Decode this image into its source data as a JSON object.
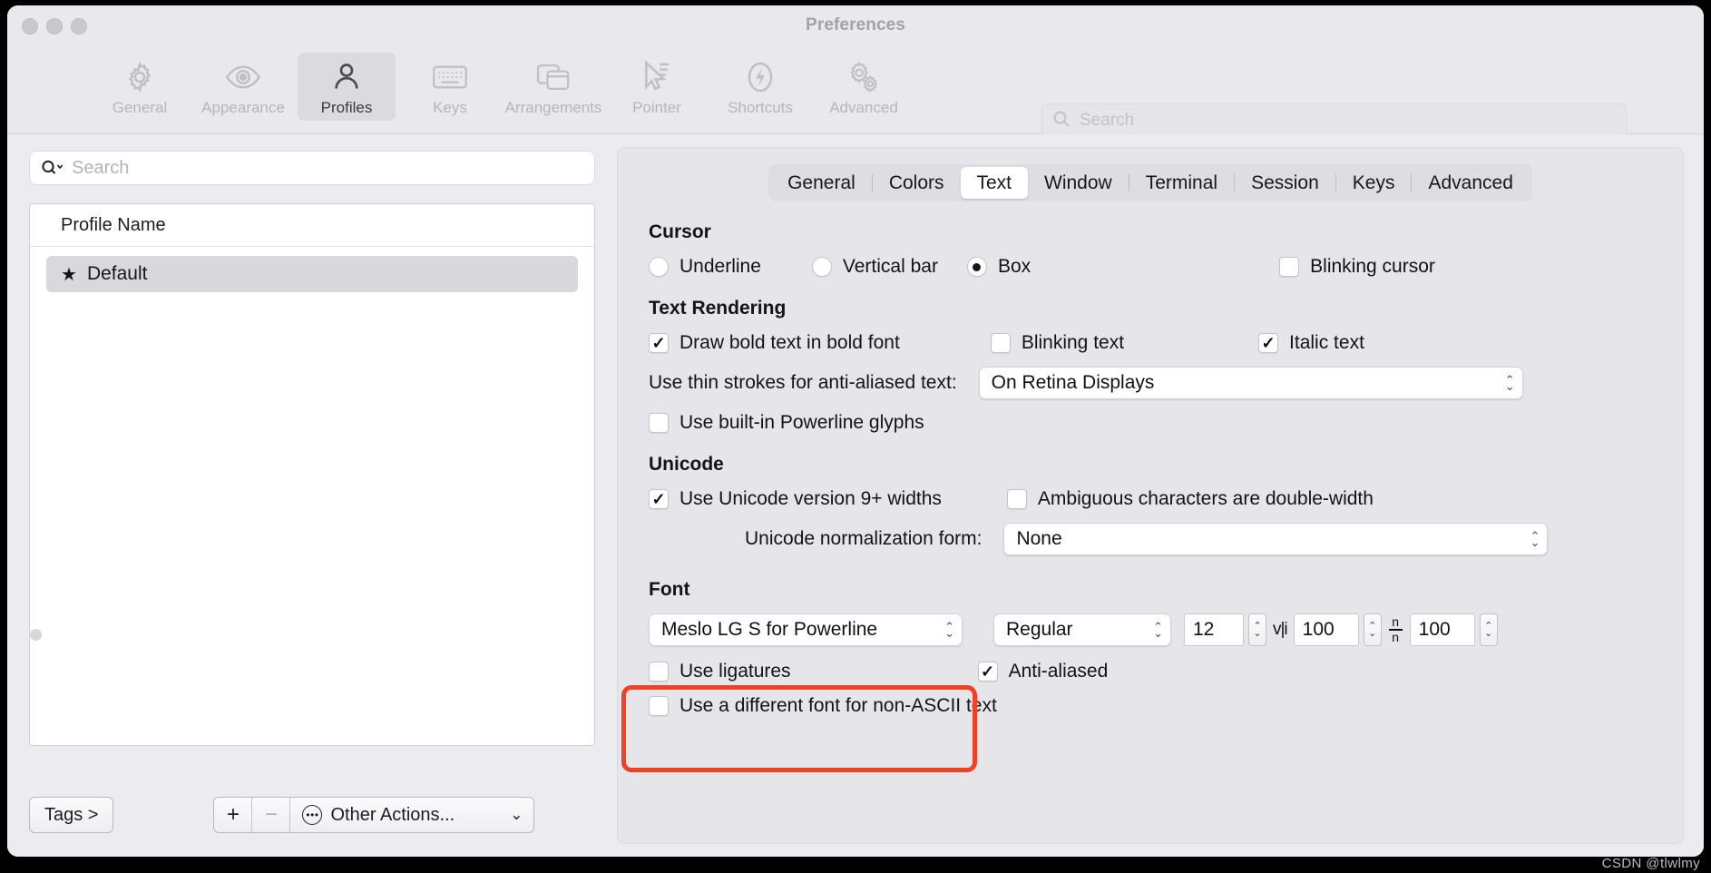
{
  "window": {
    "title": "Preferences"
  },
  "toolbar": {
    "items": [
      {
        "label": "General",
        "icon": "gear-icon",
        "active": false
      },
      {
        "label": "Appearance",
        "icon": "eye-icon",
        "active": false
      },
      {
        "label": "Profiles",
        "icon": "person-icon",
        "active": true
      },
      {
        "label": "Keys",
        "icon": "keyboard-icon",
        "active": false
      },
      {
        "label": "Arrangements",
        "icon": "windows-icon",
        "active": false
      },
      {
        "label": "Pointer",
        "icon": "cursor-arrow-icon",
        "active": false
      },
      {
        "label": "Shortcuts",
        "icon": "bolt-icon",
        "active": false
      },
      {
        "label": "Advanced",
        "icon": "gears-icon",
        "active": false
      }
    ],
    "search": {
      "placeholder": "Search",
      "value": "",
      "caption": "Search",
      "icon": "search-icon"
    }
  },
  "sidebar": {
    "search": {
      "placeholder": "Search",
      "value": "",
      "icon": "search-dropdown-icon"
    },
    "table": {
      "header": "Profile Name",
      "rows": [
        {
          "name": "Default",
          "starred": true,
          "star_glyph": "★",
          "selected": true
        }
      ]
    },
    "bottom": {
      "tags_label": "Tags >",
      "add_label": "+",
      "remove_label": "−",
      "other_actions_label": "Other Actions...",
      "other_actions_icon": "ellipsis-circle-icon",
      "chevron": "⌄"
    }
  },
  "main": {
    "tabs": [
      {
        "label": "General",
        "active": false
      },
      {
        "label": "Colors",
        "active": false
      },
      {
        "label": "Text",
        "active": true
      },
      {
        "label": "Window",
        "active": false
      },
      {
        "label": "Terminal",
        "active": false
      },
      {
        "label": "Session",
        "active": false
      },
      {
        "label": "Keys",
        "active": false
      },
      {
        "label": "Advanced",
        "active": false
      }
    ],
    "cursor": {
      "title": "Cursor",
      "options": [
        {
          "label": "Underline",
          "selected": false
        },
        {
          "label": "Vertical bar",
          "selected": false
        },
        {
          "label": "Box",
          "selected": true
        }
      ],
      "blinking": {
        "label": "Blinking cursor",
        "checked": false
      }
    },
    "text_rendering": {
      "title": "Text Rendering",
      "draw_bold": {
        "label": "Draw bold text in bold font",
        "checked": true
      },
      "blinking_text": {
        "label": "Blinking text",
        "checked": false
      },
      "italic_text": {
        "label": "Italic text",
        "checked": true
      },
      "thin_strokes": {
        "label": "Use thin strokes for anti-aliased text:",
        "value": "On Retina Displays"
      },
      "powerline": {
        "label": "Use built-in Powerline glyphs",
        "checked": false
      }
    },
    "unicode": {
      "title": "Unicode",
      "version9": {
        "label": "Use Unicode version 9+ widths",
        "checked": true
      },
      "ambiguous": {
        "label": "Ambiguous characters are double-width",
        "checked": false
      },
      "normalization": {
        "label": "Unicode normalization form:",
        "value": "None"
      }
    },
    "font": {
      "title": "Font",
      "highlight_color": "#f04124",
      "family": "Meslo LG S for Powerline",
      "weight": "Regular",
      "size": "12",
      "horizontal_spacing_icon": "v|i",
      "horizontal_spacing": "100",
      "vertical_spacing_icon": "n/n",
      "vertical_spacing": "100",
      "ligatures": {
        "label": "Use ligatures",
        "checked": false
      },
      "anti_aliased": {
        "label": "Anti-aliased",
        "checked": true
      },
      "non_ascii": {
        "label": "Use a different font for non-ASCII text",
        "checked": false
      }
    }
  },
  "watermark": "CSDN @tlwlmy"
}
